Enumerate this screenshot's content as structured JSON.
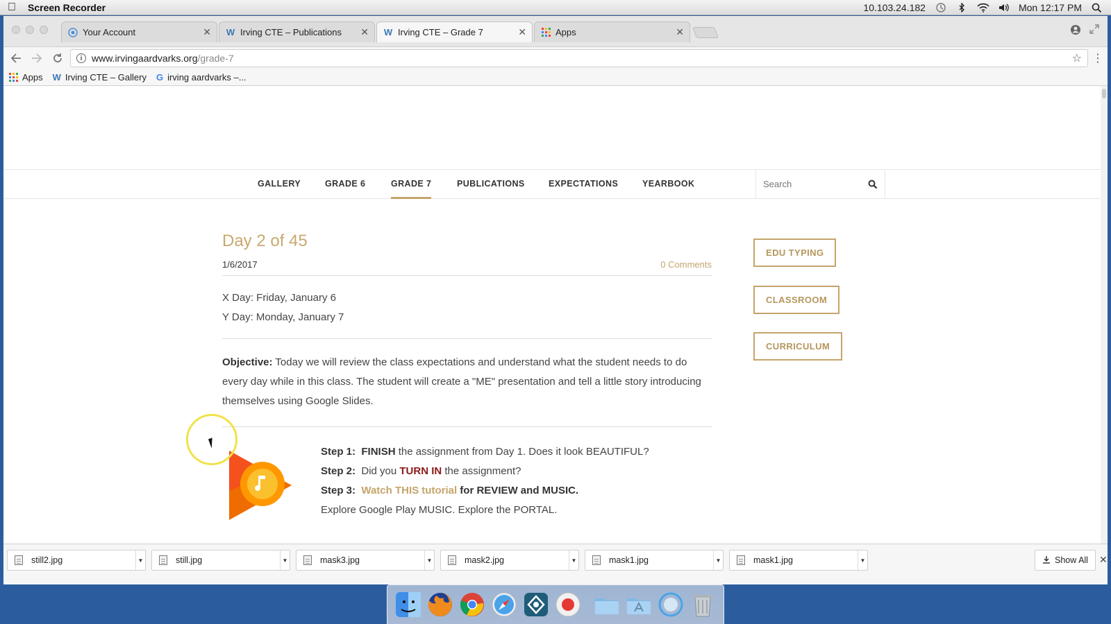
{
  "menubar": {
    "app_name": "Screen Recorder",
    "ip": "10.103.24.182",
    "clock": "Mon 12:17 PM"
  },
  "tabs": [
    {
      "title": "Your Account",
      "icon": "account-circle-icon"
    },
    {
      "title": "Irving CTE – Publications",
      "icon": "weebly-w-icon"
    },
    {
      "title": "Irving CTE – Grade 7",
      "icon": "weebly-w-icon",
      "active": true
    },
    {
      "title": "Apps",
      "icon": "apps-grid-icon"
    }
  ],
  "omnibox": {
    "host": "www.irvingaardvarks.org",
    "path": "/grade-7"
  },
  "bookmarks": [
    {
      "label": "Apps"
    },
    {
      "label": "Irving CTE – Gallery"
    },
    {
      "label": "irving aardvarks –..."
    }
  ],
  "site_nav": {
    "items": [
      "GALLERY",
      "GRADE 6",
      "GRADE 7",
      "PUBLICATIONS",
      "EXPECTATIONS",
      "YEARBOOK"
    ],
    "active": "GRADE 7",
    "search_placeholder": "Search"
  },
  "post": {
    "title": "Day 2 of 45",
    "date": "1/6/2017",
    "comments": "0 Comments",
    "x_day": "X Day:  Friday, January 6",
    "y_day": "Y Day:  Monday, January 7",
    "objective_label": "Objective:",
    "objective_text": " Today we will review the class expectations and understand what the student needs to do every day while in this class.  The student will create a \"ME\" presentation and tell a little story introducing themselves using Google Slides.",
    "step1_label": "Step 1:",
    "step1_bold": "FINISH",
    "step1_text": " the assignment from Day 1.  Does it  look BEAUTIFUL?",
    "step2_label": "Step 2:",
    "step2_pre": "Did you ",
    "step2_highlight": "TURN IN",
    "step2_post": " the assignment?",
    "step3_label": "Step 3:",
    "step3_link": "Watch THIS tutorial",
    "step3_post": " for REVIEW and MUSIC.",
    "step4_text": "Explore Google Play MUSIC.  Explore the PORTAL."
  },
  "sidebar_buttons": [
    "EDU TYPING",
    "CLASSROOM",
    "CURRICULUM"
  ],
  "downloads": [
    "still2.jpg",
    "still.jpg",
    "mask3.jpg",
    "mask2.jpg",
    "mask1.jpg",
    "mask1.jpg"
  ],
  "show_all": "Show All",
  "colors": {
    "accent_gold": "#c5a46a",
    "turn_in_red": "#8b1a1a"
  }
}
